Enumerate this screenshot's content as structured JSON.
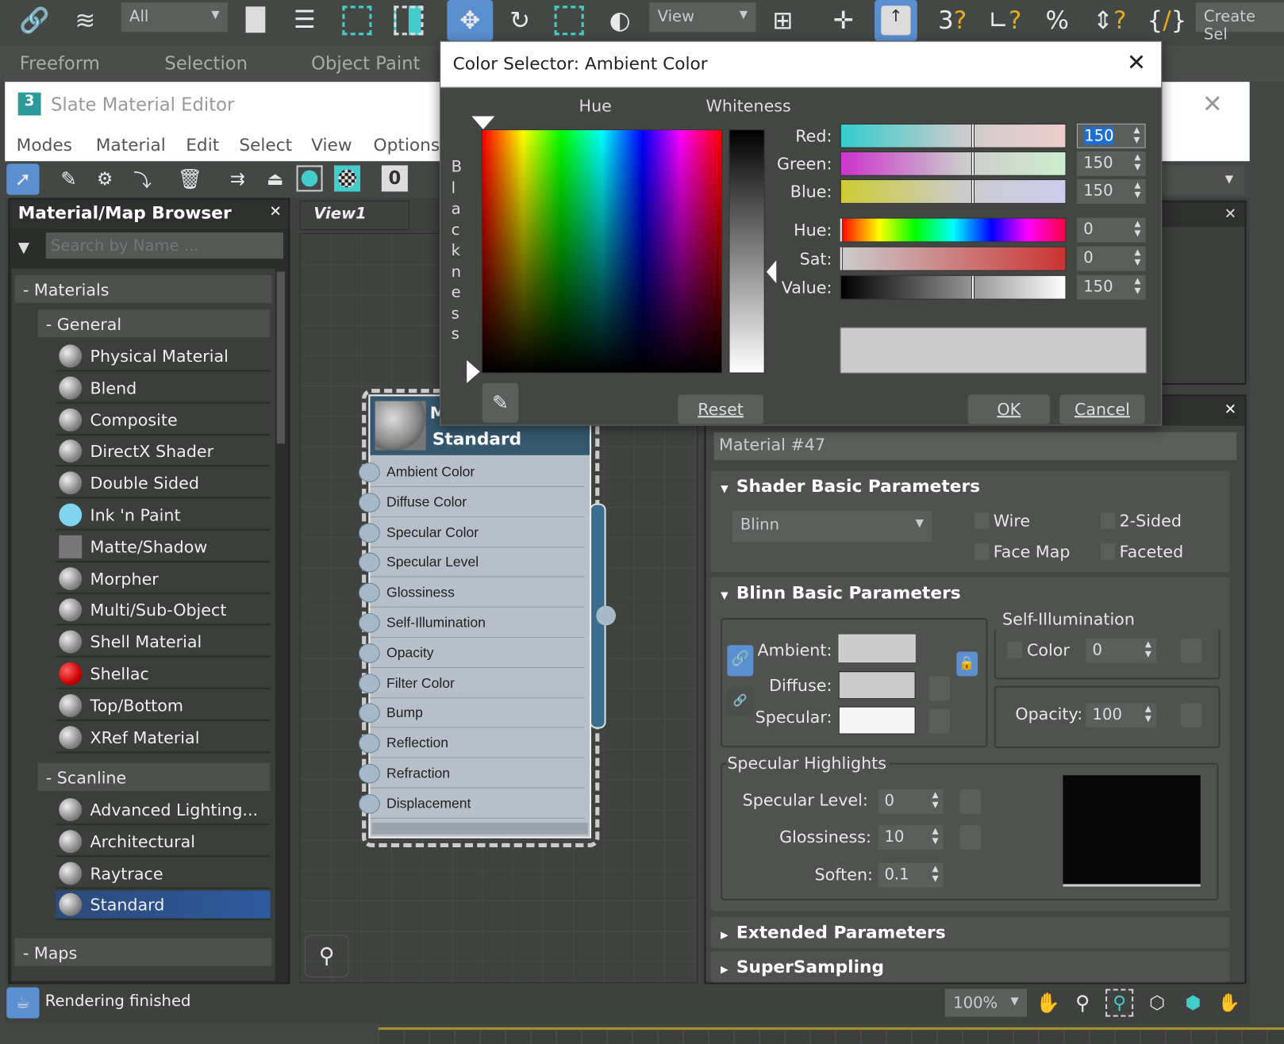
{
  "main_toolbar": {
    "selection_filter": "All",
    "ref_coord": "View",
    "create_selection": "Create Sel",
    "icons": [
      "link-icon",
      "unlink-icon",
      "select-object-icon",
      "select-by-name-icon",
      "rect-selection-icon",
      "window-crossing-icon",
      "move-icon",
      "rotate-icon",
      "scale-icon",
      "use-pivot-icon",
      "select-manipulate-icon",
      "snap-icon",
      "snaps-toggle-icon",
      "angle-snap-icon",
      "percent-snap-icon",
      "spinner-snap-icon",
      "named-selection-icon"
    ]
  },
  "ribbon_tabs": [
    "Freeform",
    "Selection",
    "Object Paint"
  ],
  "slate": {
    "title": "Slate Material Editor",
    "menu": [
      "Modes",
      "Material",
      "Edit",
      "Select",
      "View",
      "Options"
    ],
    "browser": {
      "title": "Material/Map Browser",
      "search_placeholder": "Search by Name ...",
      "materials_label": "- Materials",
      "general_label": "- General",
      "general_items": [
        "Physical Material",
        "Blend",
        "Composite",
        "DirectX Shader",
        "Double Sided",
        "Ink 'n Paint",
        "Matte/Shadow",
        "Morpher",
        "Multi/Sub-Object",
        "Shell Material",
        "Shellac",
        "Top/Bottom",
        "XRef Material"
      ],
      "scanline_label": "- Scanline",
      "scanline_items": [
        "Advanced Lighting...",
        "Architectural",
        "Raytrace",
        "Standard"
      ],
      "selected": "Standard",
      "maps_label": "- Maps"
    },
    "view_tab": "View1",
    "node": {
      "title_partial": "M",
      "type": "Standard",
      "slots": [
        "Ambient Color",
        "Diffuse Color",
        "Specular Color",
        "Specular Level",
        "Glossiness",
        "Self-Illumination",
        "Opacity",
        "Filter Color",
        "Bump",
        "Reflection",
        "Refraction",
        "Displacement"
      ]
    },
    "params": {
      "material_name": "Material #47",
      "shader_rollout": "Shader Basic Parameters",
      "shader": "Blinn",
      "wire": "Wire",
      "two_sided": "2-Sided",
      "face_map": "Face Map",
      "faceted": "Faceted",
      "blinn_rollout": "Blinn Basic Parameters",
      "ambient": "Ambient:",
      "diffuse": "Diffuse:",
      "specular": "Specular:",
      "ambient_color": "#cccccc",
      "diffuse_color": "#cccccc",
      "specular_color": "#f5f5f5",
      "self_illum_title": "Self-Illumination",
      "color_label": "Color",
      "self_illum_value": "0",
      "opacity_label": "Opacity:",
      "opacity_value": "100",
      "spec_highlights": "Specular Highlights",
      "spec_level_label": "Specular Level:",
      "spec_level": "0",
      "glossiness_label": "Glossiness:",
      "glossiness": "10",
      "soften_label": "Soften:",
      "soften": "0.1",
      "extended": "Extended Parameters",
      "supersampling": "SuperSampling"
    },
    "status": "Rendering finished",
    "zoom": "100%"
  },
  "color_dialog": {
    "title": "Color Selector: Ambient Color",
    "hue_label": "Hue",
    "whiteness_label": "Whiteness",
    "blackness_label": "Blackness",
    "red_label": "Red:",
    "green_label": "Green:",
    "blue_label": "Blue:",
    "hue_val_label": "Hue:",
    "sat_label": "Sat:",
    "value_label": "Value:",
    "red": "150",
    "green": "150",
    "blue": "150",
    "hue": "0",
    "sat": "0",
    "value": "150",
    "preview_color": "#cccccc",
    "reset": "Reset",
    "ok": "OK",
    "cancel": "Cancel"
  }
}
